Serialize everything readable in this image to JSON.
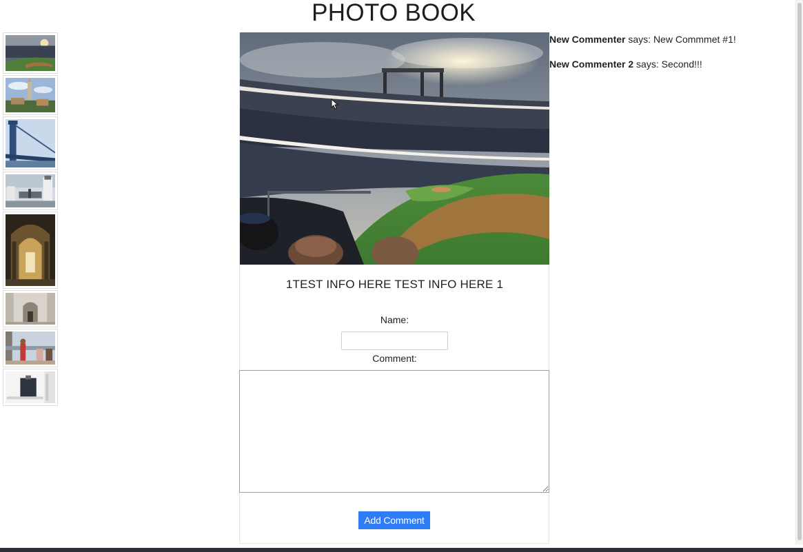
{
  "page": {
    "title": "PHOTO BOOK"
  },
  "thumbnails": [
    {
      "name": "stadium-thumbnail",
      "alt": "stadium"
    },
    {
      "name": "church-spire-thumbnail",
      "alt": "spire"
    },
    {
      "name": "bridge-thumbnail",
      "alt": "bridge"
    },
    {
      "name": "harbor-thumbnail",
      "alt": "harbor"
    },
    {
      "name": "cathedral-interior-thumbnail",
      "alt": "cathedral"
    },
    {
      "name": "arch-interior-thumbnail",
      "alt": "arch"
    },
    {
      "name": "terrace-crowd-thumbnail",
      "alt": "terrace"
    },
    {
      "name": "building-window-thumbnail",
      "alt": "window"
    }
  ],
  "main": {
    "info": "1TEST INFO HERE TEST INFO HERE 1",
    "name_label": "Name:",
    "name_value": "",
    "comment_label": "Comment:",
    "comment_value": "",
    "add_button": "Add Comment"
  },
  "comments": [
    {
      "author": "New Commenter",
      "says": " says: ",
      "text": "New Commmet #1!"
    },
    {
      "author": "New Commenter 2",
      "says": " says: ",
      "text": "Second!!!"
    }
  ],
  "colors": {
    "button": "#2f7df6",
    "text": "#212529"
  }
}
